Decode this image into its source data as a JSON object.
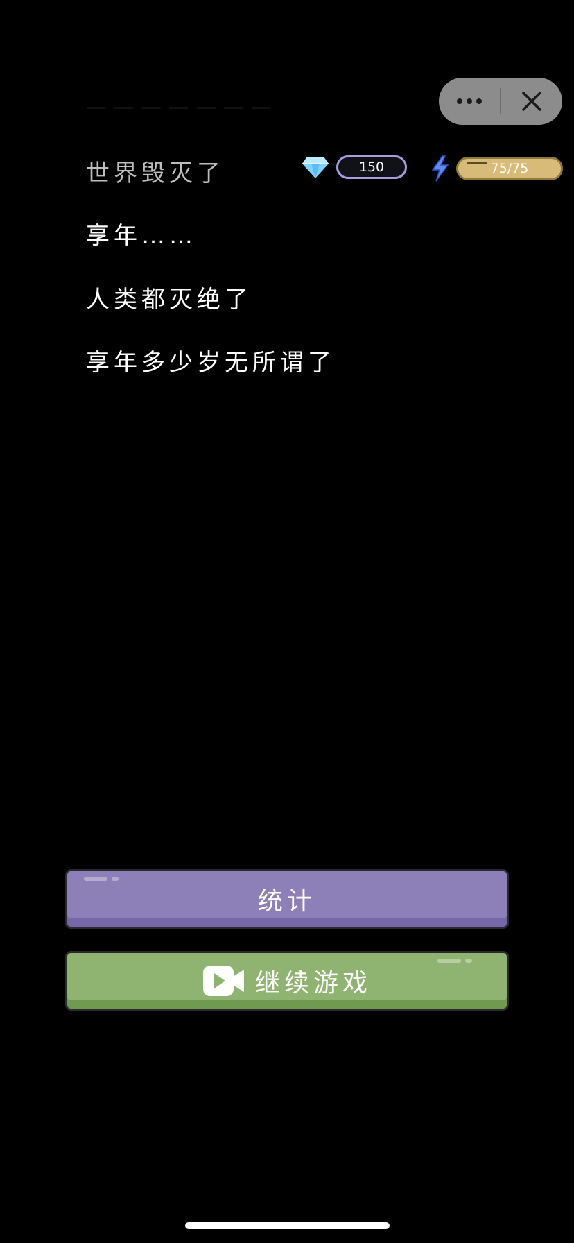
{
  "history": {
    "lines": [
      "世界毁灭了",
      "享年……",
      "人类都灭绝了",
      "享年多少岁无所谓了"
    ]
  },
  "resources": {
    "gems": "150",
    "energy": "75/75"
  },
  "buttons": {
    "stats_label": "统计",
    "continue_label": "继续游戏"
  },
  "icons": {
    "menu": "more-icon",
    "close": "close-icon",
    "gem": "diamond-icon",
    "energy": "lightning-icon",
    "video": "video-camera-icon"
  },
  "colors": {
    "background": "#000000",
    "stats_button": "#8d7fb8",
    "continue_button": "#8fb471",
    "energy_bar": "#d8bb78",
    "gem_border": "#a89cdc"
  }
}
